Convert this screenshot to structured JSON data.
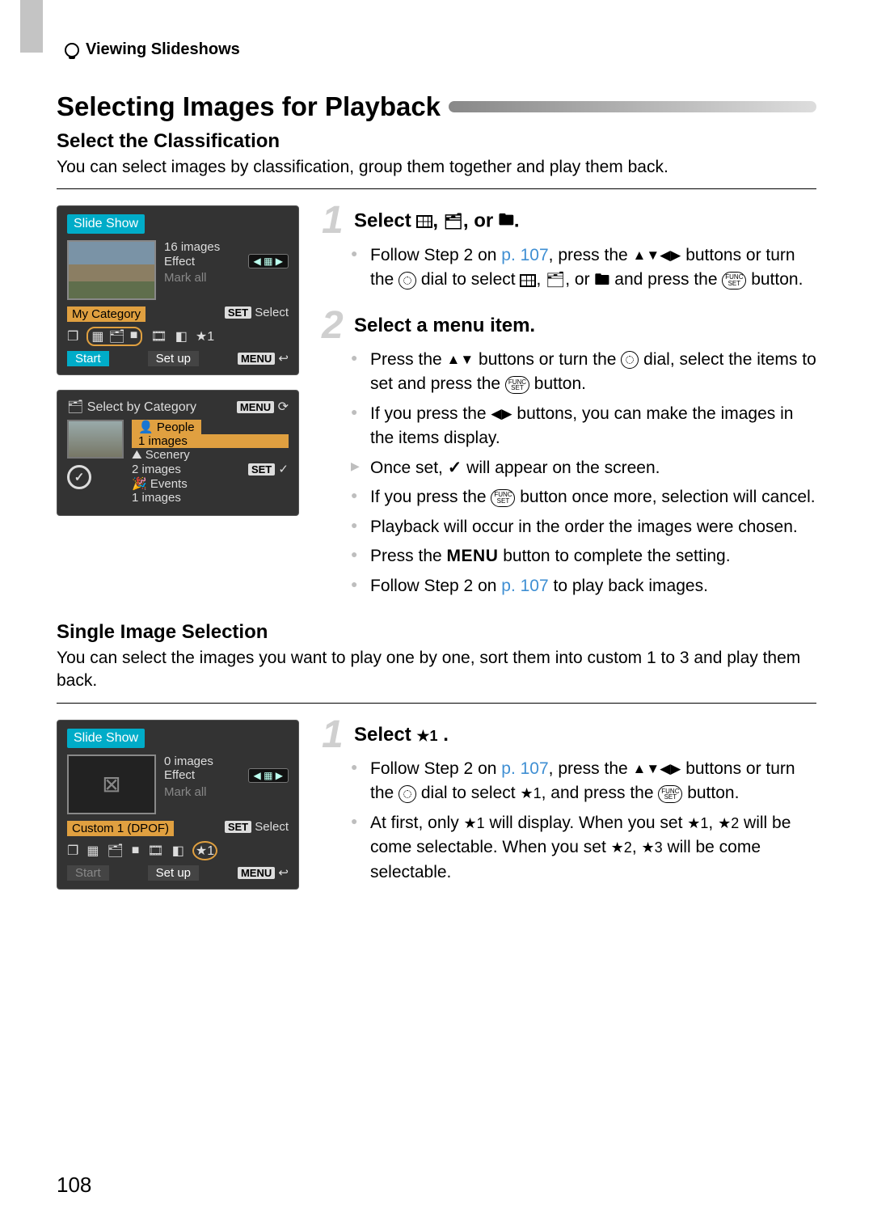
{
  "breadcrumb": "Viewing Slideshows",
  "main_title": "Selecting Images for Playback",
  "section1": {
    "subhead": "Select the Classification",
    "body": "You can select images by classification, group them together and play them back.",
    "cam1": {
      "title": "Slide Show",
      "images_count": "16 images",
      "effect_label": "Effect",
      "mark_all": "Mark all",
      "category": "My Category",
      "set_label": "SET",
      "select_label": "Select",
      "start": "Start",
      "setup": "Set up",
      "menu": "MENU",
      "star": "★1"
    },
    "cam2": {
      "title": "Select by Category",
      "menu": "MENU",
      "cat_people": "People",
      "cat_people_count": "1 images",
      "cat_scenery": "Scenery",
      "cat_scenery_count": "2 images",
      "cat_events": "Events",
      "cat_events_count": "1 images",
      "set": "SET",
      "check": "✓"
    },
    "step1": {
      "num": "1",
      "title_pre": "Select ",
      "title_mid": ", ",
      "title_mid2": ", or ",
      "title_end": ".",
      "b1_pre": "Follow Step 2 on ",
      "b1_link": "p. 107",
      "b1_post": ", press the ",
      "b1_line2_mid": " buttons or turn the ",
      "b1_line2_end": " dial to select ",
      "b1_line3_mid": ", ",
      "b1_line3_mid2": ", or ",
      "b1_line3_end": " and press the ",
      "b1_line3_button": " button."
    },
    "step2": {
      "num": "2",
      "title": "Select a menu item.",
      "b1_pre": "Press the ",
      "b1_mid": " buttons or turn the ",
      "b1_end": " dial, select the items to set and press the ",
      "b1_last": " button.",
      "b2_pre": "If you press the ",
      "b2_end": " buttons, you can make the images in the items display.",
      "b3_pre": "Once set, ",
      "b3_end": " will appear on the screen.",
      "b4_pre": "If you press the ",
      "b4_end": " button once more, selection will cancel.",
      "b5": "Playback will occur in the order the images were chosen.",
      "b6_pre": "Press the ",
      "b6_menu": "MENU",
      "b6_end": " button to complete the setting.",
      "b7_pre": "Follow Step 2 on ",
      "b7_link": "p. 107",
      "b7_end": " to play back images."
    }
  },
  "section2": {
    "subhead": "Single Image Selection",
    "body": "You can select the images you want to play one by one, sort them into custom 1 to 3 and play them back.",
    "cam": {
      "title": "Slide Show",
      "images_count": "0 images",
      "effect_label": "Effect",
      "mark_all": "Mark all",
      "custom": "Custom 1 (DPOF)",
      "set_label": "SET",
      "select_label": "Select",
      "start": "Start",
      "setup": "Set up",
      "menu": "MENU"
    },
    "step1": {
      "num": "1",
      "title_pre": "Select ",
      "title_star": "★1",
      "title_end": ".",
      "b1_pre": "Follow Step 2 on ",
      "b1_link": "p. 107",
      "b1_post": ", press the ",
      "b1_line2_mid": " buttons or turn the ",
      "b1_line2_end": " dial to select ",
      "b1_star": "★1",
      "b1_line3_end": ", and press the ",
      "b1_button": " button.",
      "b2_pre": "At first, only ",
      "b2_star1": "★1",
      "b2_mid": " will display. When you set ",
      "b2_star1b": "★1",
      "b2_comma": ", ",
      "b2_star2": "★2",
      "b2_mid2": " will be come selectable. When you set ",
      "b2_star2b": "★2",
      "b2_comma2": ", ",
      "b2_star3": "★3",
      "b2_end": " will be come selectable."
    }
  },
  "page_number": "108"
}
